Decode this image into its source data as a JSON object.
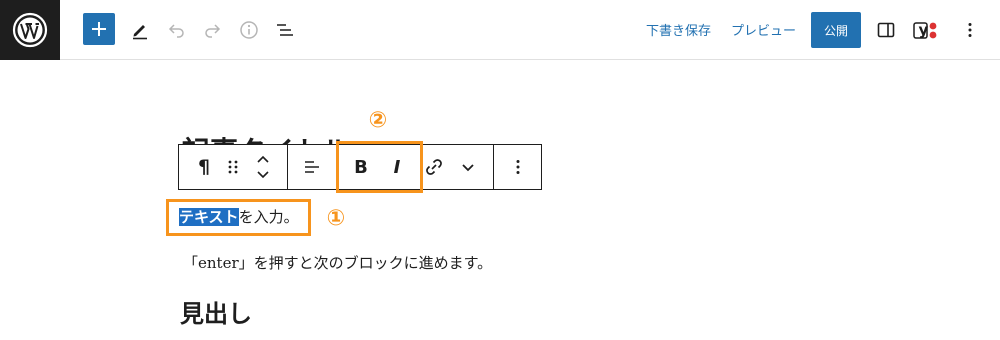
{
  "topbar": {
    "save_draft": "下書き保存",
    "preview": "プレビュー",
    "publish": "公開",
    "yoast_label": "y"
  },
  "editor": {
    "partial_heading": "記事タイトル",
    "selected_text": "テキスト",
    "paragraph_rest": "を入力。",
    "paragraph2": "「enter」を押すと次のブロックに進めます。",
    "heading": "見出し"
  },
  "block_toolbar": {
    "paragraph_icon": "¶",
    "bold": "B",
    "italic": "I"
  },
  "annotations": {
    "marker1": "①",
    "marker2": "②",
    "color": "#f7941d"
  },
  "colors": {
    "accent": "#2271b1",
    "selection": "#1f6fc3",
    "dark": "#1e1e1e"
  }
}
